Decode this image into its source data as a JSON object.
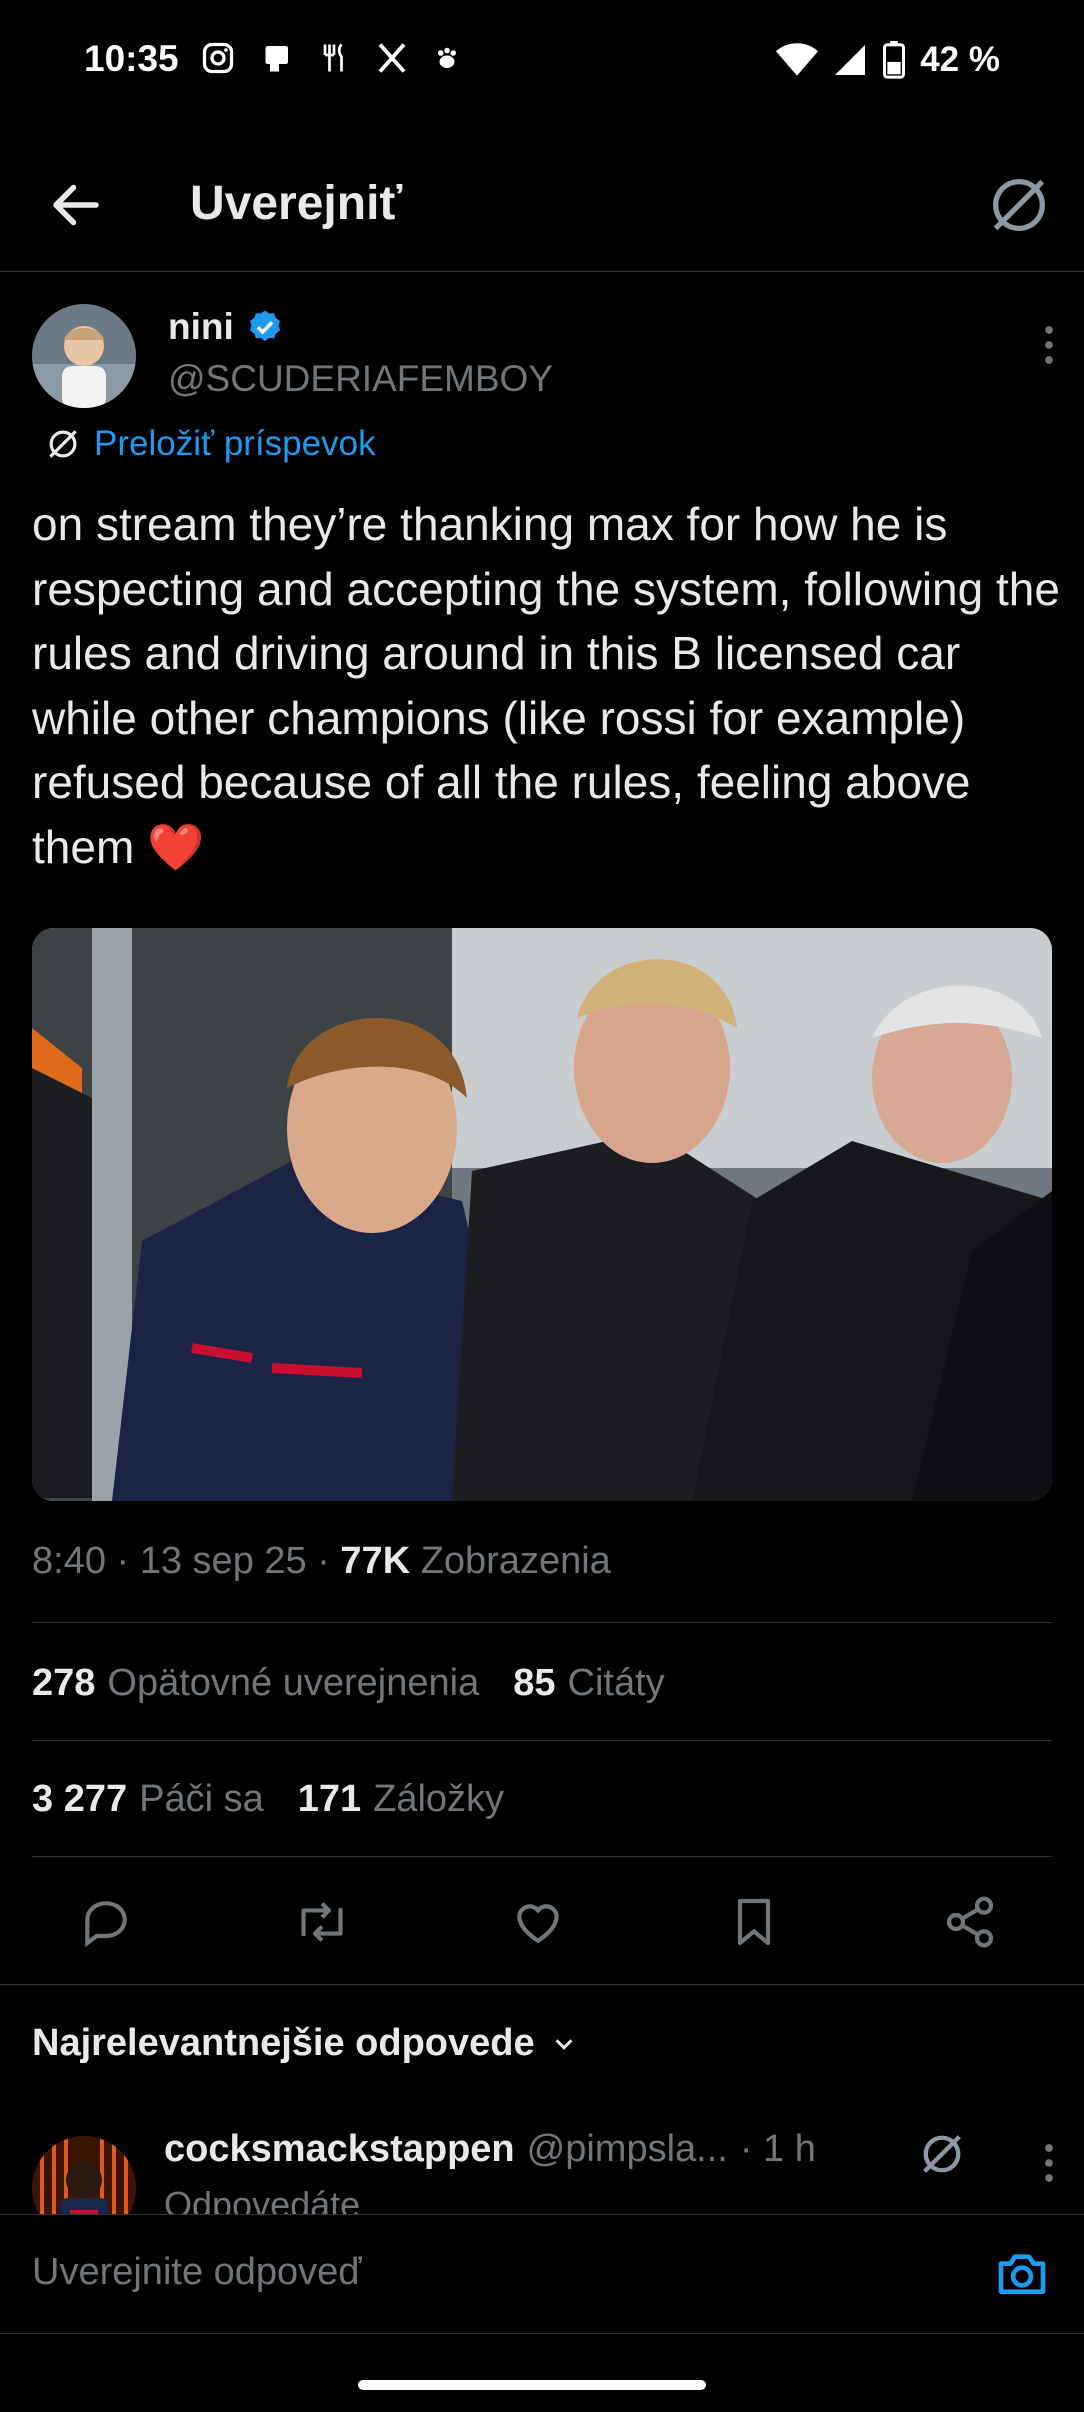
{
  "status_bar": {
    "time": "10:35",
    "battery": "42 %",
    "icons": [
      "instagram-icon",
      "tablet-icon",
      "restaurant-icon",
      "x-logo-icon",
      "paw-icon",
      "wifi-icon",
      "signal-icon",
      "battery-icon"
    ]
  },
  "header": {
    "title": "Uverejniť",
    "back_icon": "arrow-left-icon",
    "translate_icon": "translate-icon"
  },
  "post": {
    "author_name": "nini",
    "verified": true,
    "handle": "@SCUDERIAFEMBOY",
    "translate_label": "Preložiť príspevok",
    "text": "on stream they’re thanking max for how he is respecting and accepting the system, following the rules and driving around in this B licensed car while other champions (like rossi for example) refused because of all the rules, feeling above them ❤️",
    "meta_time_date": "8:40 · 13 sep 25 · ",
    "views_count": "77K",
    "views_label": "Zobrazenia"
  },
  "stats": {
    "reposts_count": "278",
    "reposts_label": "Opätovné uverejnenia",
    "quotes_count": "85",
    "quotes_label": "Citáty",
    "likes_count": "3 277",
    "likes_label": "Páči sa",
    "bookmarks_count": "171",
    "bookmarks_label": "Záložky"
  },
  "actions": [
    "reply-icon",
    "repost-icon",
    "like-icon",
    "bookmark-icon",
    "share-icon"
  ],
  "replies": {
    "sort_label": "Najrelevantnejšie odpovede",
    "first": {
      "name": "cocksmackstappen",
      "handle": "@pimpsla...",
      "time": "· 1 h",
      "subtext": "Odpovedáte"
    }
  },
  "compose": {
    "placeholder": "Uverejnite odpoveď"
  },
  "colors": {
    "background": "#000000",
    "accent": "#1d9bf0",
    "secondary_text": "#71767b",
    "heart": "#e0245e"
  }
}
